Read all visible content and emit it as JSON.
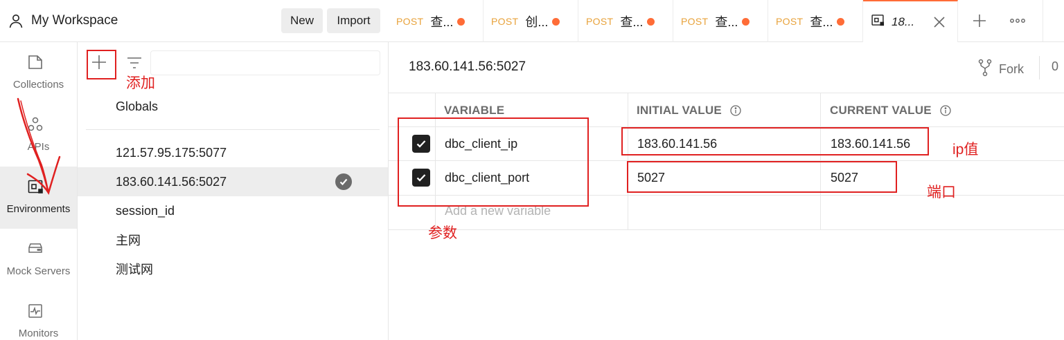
{
  "workspace": {
    "title": "My Workspace",
    "new_label": "New",
    "import_label": "Import"
  },
  "rail": {
    "items": [
      {
        "label": "Collections",
        "icon": "collections-icon"
      },
      {
        "label": "APIs",
        "icon": "apis-icon"
      },
      {
        "label": "Environments",
        "icon": "environments-icon",
        "active": true
      },
      {
        "label": "Mock Servers",
        "icon": "mock-servers-icon"
      },
      {
        "label": "Monitors",
        "icon": "monitors-icon"
      }
    ]
  },
  "environments": {
    "globals": "Globals",
    "items": [
      {
        "name": "121.57.95.175:5077"
      },
      {
        "name": "183.60.141.56:5027",
        "selected": true
      },
      {
        "name": "session_id"
      },
      {
        "name": "主网"
      },
      {
        "name": "测试网"
      }
    ]
  },
  "tabs": [
    {
      "method": "POST",
      "name": "查..."
    },
    {
      "method": "POST",
      "name": "创..."
    },
    {
      "method": "POST",
      "name": "查..."
    },
    {
      "method": "POST",
      "name": "查..."
    },
    {
      "method": "POST",
      "name": "查..."
    },
    {
      "method": "",
      "name": "18...",
      "active": true
    }
  ],
  "env_detail": {
    "title": "183.60.141.56:5027",
    "fork_label": "Fork",
    "fork_count": "0",
    "columns": {
      "variable": "VARIABLE",
      "initial": "INITIAL VALUE",
      "current": "CURRENT VALUE"
    },
    "rows": [
      {
        "variable": "dbc_client_ip",
        "initial": "183.60.141.56",
        "current": "183.60.141.56",
        "enabled": true
      },
      {
        "variable": "dbc_client_port",
        "initial": "5027",
        "current": "5027",
        "enabled": true
      }
    ],
    "add_placeholder": "Add a new variable"
  },
  "annotations": {
    "add": "添加",
    "params": "参数",
    "ip_value": "ip值",
    "port": "端口"
  },
  "colors": {
    "accent": "#ff6c37",
    "annotation": "#e02020",
    "method": "#e8a23a"
  }
}
